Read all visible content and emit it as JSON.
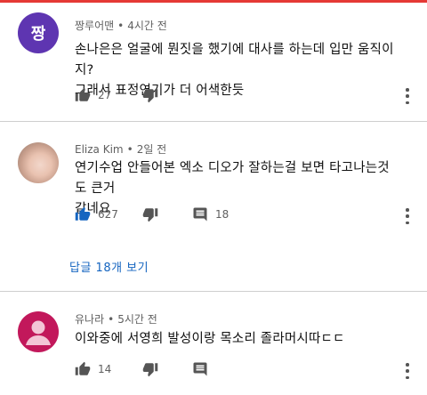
{
  "colors": {
    "link": "#1565c0",
    "like_active": "#1565c0",
    "icon": "#555555",
    "avatar1": "#5e35b1",
    "avatar3": "#c2185b"
  },
  "comments": [
    {
      "avatar_letter": "짱",
      "author": "짱루어맨",
      "time": "4시간 전",
      "text_lines": [
        "손나은은 얼굴에 뭔짓을 했기에 대사를 하는데  입만 움직이지?",
        "그래서 표정연기가 더 어색한듯"
      ],
      "likes": "27"
    },
    {
      "author": "Eliza Kim",
      "time": "2일 전",
      "text_lines": [
        "연기수업 안들어본 엑소 디오가 잘하는걸 보면 타고나는것도 큰거",
        "같네요"
      ],
      "likes": "627",
      "replies_count": "18",
      "replies_link": "답글 18개 보기"
    },
    {
      "author": "유나라",
      "time": "5시간 전",
      "text_lines": [
        "이와중에 서영희 발성이랑 목소리 졸라머시따ㄷㄷ"
      ],
      "likes": "14"
    }
  ],
  "dot_separator": "•"
}
